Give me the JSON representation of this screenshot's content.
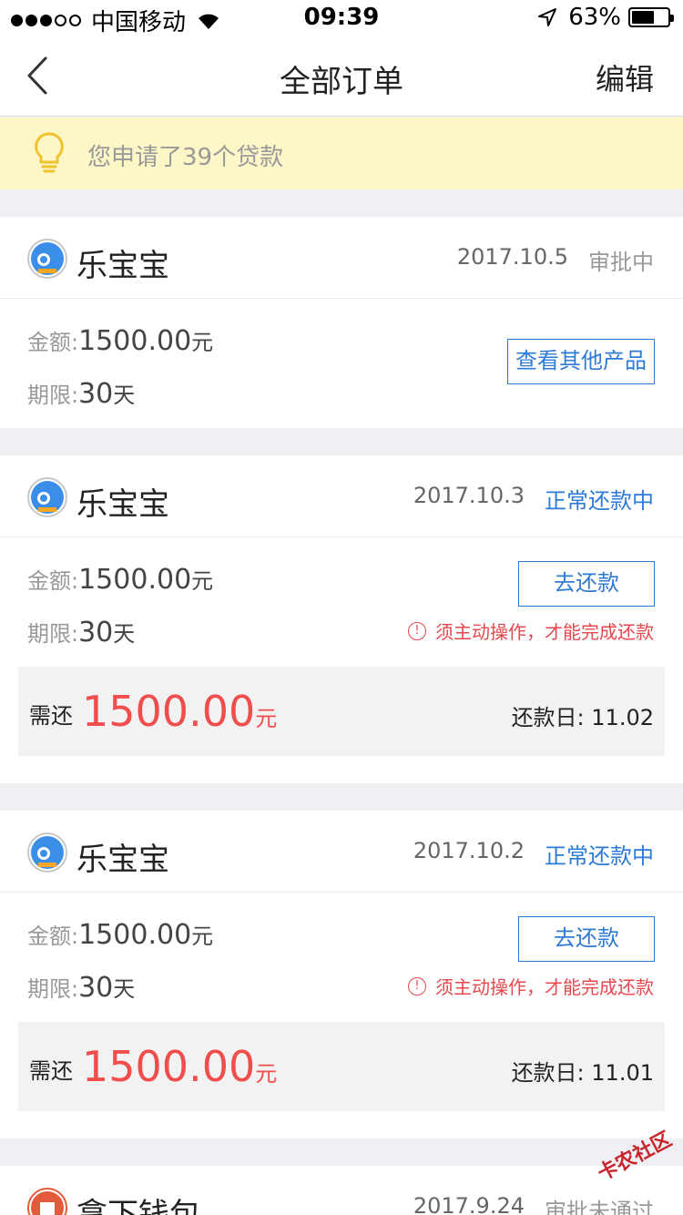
{
  "status_bar": {
    "carrier": "中国移动",
    "time": "09:39",
    "battery_percent": "63%",
    "battery_level": 0.63
  },
  "nav": {
    "title": "全部订单",
    "edit_label": "编辑"
  },
  "notice": {
    "text": "您申请了39个贷款"
  },
  "labels": {
    "amount": "金额:",
    "term": "期限:",
    "currency_unit": "元",
    "day_unit": "天",
    "due_label": "需还",
    "repay_day_label": "还款日: "
  },
  "orders": [
    {
      "name": "乐宝宝",
      "date": "2017.10.5",
      "status": "审批中",
      "amount": "1500.00",
      "term": "30",
      "action_label": "查看其他产品"
    },
    {
      "name": "乐宝宝",
      "date": "2017.10.3",
      "status": "正常还款中",
      "amount": "1500.00",
      "term": "30",
      "action_label": "去还款",
      "warning": "须主动操作，才能完成还款",
      "due_amount": "1500.00",
      "repay_day": "11.02"
    },
    {
      "name": "乐宝宝",
      "date": "2017.10.2",
      "status": "正常还款中",
      "amount": "1500.00",
      "term": "30",
      "action_label": "去还款",
      "warning": "须主动操作，才能完成还款",
      "due_amount": "1500.00",
      "repay_day": "11.01"
    },
    {
      "name": "拿下钱包",
      "date": "2017.9.24",
      "status": "审批未通过"
    }
  ],
  "watermark": "卡农社区",
  "colors": {
    "accent_blue": "#2e7bd6",
    "warning_red": "#e5484d",
    "amount_red": "#f04d4d",
    "notice_bg": "#fdf7c8"
  }
}
